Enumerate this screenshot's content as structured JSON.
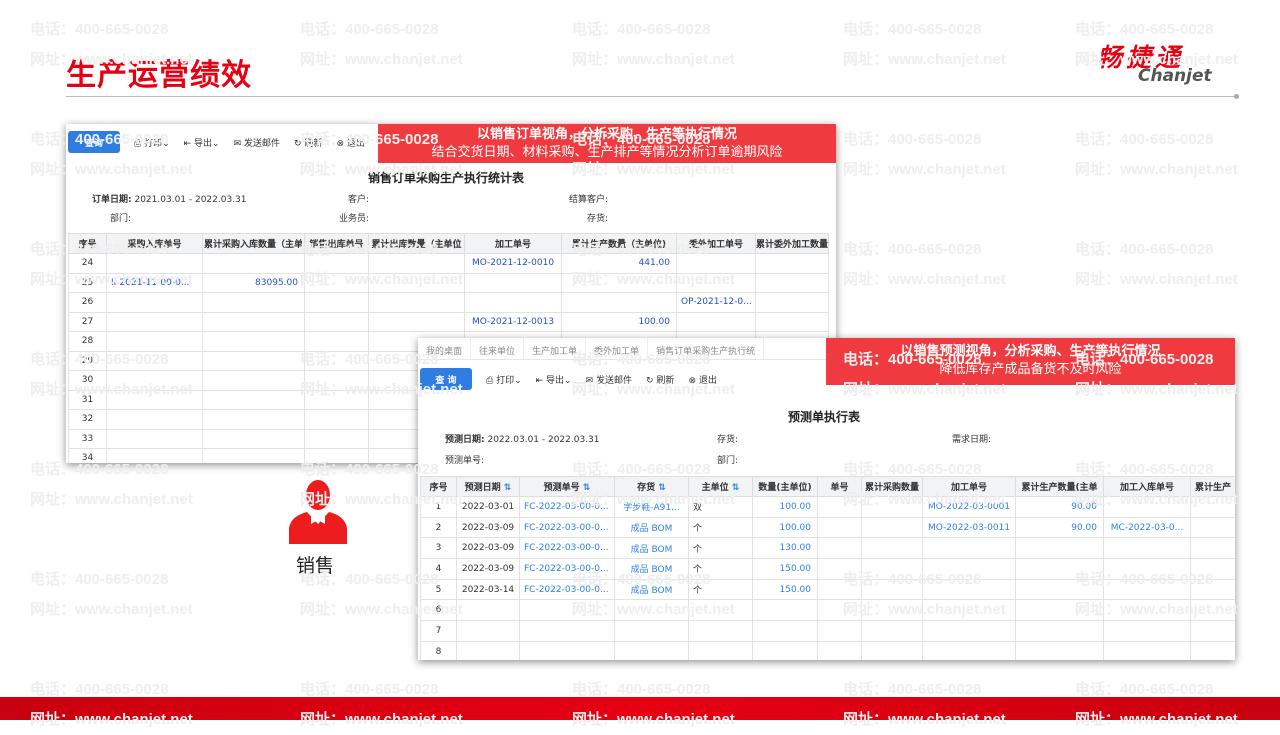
{
  "slide": {
    "title": "生产运营绩效",
    "logo_cn": "畅捷通",
    "logo_en": "Chanjet",
    "role_label": "销售",
    "watermark": {
      "phone": "电话：400-665-0028",
      "site": "网址：www.chanjet.net"
    },
    "colors": {
      "brand_red": "#e60012",
      "banner_red": "#ef3b3f",
      "query_blue": "#2f7de1"
    }
  },
  "report1": {
    "banner": [
      "以销售订单视角，分析采购、生产等执行情况",
      "结合交货日期、材料采购、生产排产等情况分析订单逾期风险"
    ],
    "toolbar": {
      "query": "查询",
      "print": "打印",
      "export": "导出",
      "email": "发送邮件",
      "refresh": "刷新",
      "exit": "退出"
    },
    "title": "销售订单采购生产执行统计表",
    "filters": {
      "date_label": "订单日期:",
      "date_value": "2021.03.01 - 2022.03.31",
      "customer": "客户:",
      "settle": "结算客户:",
      "dept": "部门:",
      "sales": "业务员:",
      "inventory": "存货:"
    },
    "columns": [
      "序号",
      "采购入库单号",
      "累计采购入库数量（主单",
      "销售出库单号",
      "累计出库数量（主单位",
      "加工单号",
      "累计生产数量（主单位)",
      "委外加工单号",
      "累计委外加工数量"
    ],
    "rows": [
      [
        "24",
        "",
        "",
        "",
        "",
        "MO-2021-12-0010",
        "441.00",
        "",
        ""
      ],
      [
        "25",
        "II-2021-11-00-0...",
        "83095.00",
        "",
        "",
        "",
        "",
        "",
        ""
      ],
      [
        "26",
        "",
        "",
        "",
        "",
        "",
        "",
        "OP-2021-12-0...",
        ""
      ],
      [
        "27",
        "",
        "",
        "",
        "",
        "MO-2021-12-0013",
        "100.00",
        "",
        ""
      ],
      [
        "28",
        "",
        "",
        "",
        "",
        "",
        "",
        "",
        ""
      ],
      [
        "29",
        "",
        "",
        "",
        "",
        "",
        "",
        "",
        ""
      ],
      [
        "30",
        "",
        "",
        "",
        "",
        "",
        "",
        "",
        ""
      ],
      [
        "31",
        "",
        "",
        "",
        "",
        "",
        "",
        "",
        ""
      ],
      [
        "32",
        "",
        "",
        "",
        "",
        "",
        "",
        "",
        ""
      ],
      [
        "33",
        "",
        "",
        "",
        "",
        "",
        "",
        "",
        ""
      ],
      [
        "34",
        "",
        "",
        "",
        "",
        "",
        "",
        "",
        ""
      ]
    ]
  },
  "report2": {
    "tabs": [
      "我的桌面",
      "往来单位",
      "生产加工单",
      "委外加工单",
      "销售订单采购生产执行统"
    ],
    "banner": [
      "以销售预测视角，分析采购、生产等执行情况",
      "降低库存产成品备货不及时风险"
    ],
    "toolbar": {
      "query": "查 询",
      "print": "打印",
      "export": "导出",
      "email": "发送邮件",
      "refresh": "刷新",
      "exit": "退出"
    },
    "title": "预测单执行表",
    "filters": {
      "date_label": "预测日期:",
      "date_value": "2022.03.01 - 2022.03.31",
      "inventory": "存货:",
      "need_date": "需求日期:",
      "order_no": "预测单号:",
      "dept": "部门:"
    },
    "columns": [
      "序号",
      "预测日期",
      "预测单号",
      "存货",
      "主单位",
      "数量(主单位)",
      "单号",
      "累计采购数量",
      "加工单号",
      "累计生产数量(主单",
      "加工入库单号",
      "累计生产"
    ],
    "rows": [
      [
        "1",
        "2022-03-01",
        "FC-2022-03-00-0...",
        "学步鞋-A91...",
        "双",
        "100.00",
        "",
        "",
        "MO-2022-03-0001",
        "90.00",
        "",
        ""
      ],
      [
        "2",
        "2022-03-09",
        "FC-2022-03-00-0...",
        "成品 BOM",
        "个",
        "100.00",
        "",
        "",
        "MO-2022-03-0011",
        "90.00",
        "MC-2022-03-0...",
        ""
      ],
      [
        "3",
        "2022-03-09",
        "FC-2022-03-00-0...",
        "成品 BOM",
        "个",
        "130.00",
        "",
        "",
        "",
        "",
        "",
        ""
      ],
      [
        "4",
        "2022-03-09",
        "FC-2022-03-00-0...",
        "成品 BOM",
        "个",
        "150.00",
        "",
        "",
        "",
        "",
        "",
        ""
      ],
      [
        "5",
        "2022-03-14",
        "FC-2022-03-00-0...",
        "成品 BOM",
        "个",
        "150.00",
        "",
        "",
        "",
        "",
        "",
        ""
      ],
      [
        "6",
        "",
        "",
        "",
        "",
        "",
        "",
        "",
        "",
        "",
        "",
        ""
      ],
      [
        "7",
        "",
        "",
        "",
        "",
        "",
        "",
        "",
        "",
        "",
        "",
        ""
      ],
      [
        "8",
        "",
        "",
        "",
        "",
        "",
        "",
        "",
        "",
        "",
        "",
        ""
      ]
    ]
  }
}
